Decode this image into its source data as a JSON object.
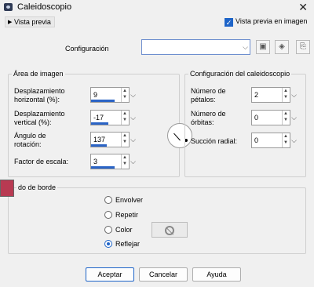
{
  "window": {
    "title": "Caleidoscopio",
    "close": "✕"
  },
  "topbar": {
    "preview_toggle": "Vista previa",
    "preview_on_image": "Vista previa en imagen"
  },
  "config": {
    "label": "Configuración",
    "value": ""
  },
  "image_area": {
    "title": "Área de imagen",
    "h_offset": {
      "label1": "Desplazamiento",
      "label2": "horizontal (%):",
      "value": "9",
      "level": 0.55
    },
    "v_offset": {
      "label1": "Desplazamiento",
      "label2": "vertical (%):",
      "value": "-17",
      "level": 0.42
    },
    "rotation": {
      "label1": "Ángulo de",
      "label2": "rotación:",
      "value": "137",
      "level": 0.38
    },
    "scale": {
      "label": "Factor de escala:",
      "value": "3",
      "level": 0.6
    }
  },
  "kaleido": {
    "title": "Configuración del caleidoscopio",
    "petals": {
      "label1": "Número de",
      "label2": "pétalos:",
      "value": "2"
    },
    "orbits": {
      "label1": "Número de",
      "label2": "órbitas:",
      "value": "0"
    },
    "radial": {
      "label": "Succión radial:",
      "value": "0"
    }
  },
  "edge": {
    "title": "do de borde",
    "swatch_color": "#b83a52",
    "options": [
      "Envolver",
      "Repetir",
      "Color",
      "Reflejar"
    ],
    "selected": "Reflejar"
  },
  "buttons": {
    "ok": "Aceptar",
    "cancel": "Cancelar",
    "help": "Ayuda"
  }
}
